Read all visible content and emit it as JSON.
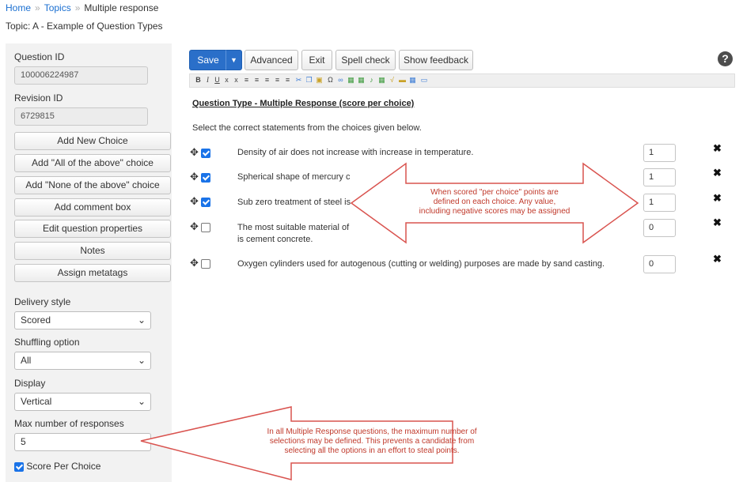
{
  "breadcrumb": {
    "home": "Home",
    "sep": "»",
    "topics": "Topics",
    "current": "Multiple response"
  },
  "topic_line": "Topic: A - Example of Question Types",
  "sidebar": {
    "question_id_label": "Question ID",
    "question_id_value": "100006224987",
    "revision_id_label": "Revision ID",
    "revision_id_value": "6729815",
    "buttons": [
      "Add New Choice",
      "Add \"All of the above\" choice",
      "Add \"None of the above\" choice",
      "Add comment box",
      "Edit question properties",
      "Notes",
      "Assign metatags"
    ],
    "delivery_label": "Delivery style",
    "delivery_value": "Scored",
    "shuffling_label": "Shuffling option",
    "shuffling_value": "All",
    "display_label": "Display",
    "display_value": "Vertical",
    "max_label": "Max number of responses",
    "max_value": "5",
    "score_per_choice_label": "Score Per Choice",
    "score_per_choice_checked": true
  },
  "toolbar": {
    "save": "Save",
    "advanced": "Advanced",
    "exit": "Exit",
    "spell": "Spell check",
    "feedback": "Show feedback",
    "help": "?"
  },
  "question": {
    "title": "Question Type - Multiple Response (score per choice)",
    "instruction": "Select the correct statements from the choices given below.",
    "choices": [
      {
        "line1": "Density of air does not increase with increase in temperature.",
        "line2": "",
        "checked": true,
        "score": "1"
      },
      {
        "line1": "Spherical shape of mercury c",
        "line2": "",
        "checked": true,
        "score": "1"
      },
      {
        "line1": "Sub zero treatment of steel is",
        "line2": "",
        "checked": true,
        "score": "1"
      },
      {
        "line1": "The most suitable material of",
        "line2": "is cement concrete.",
        "checked": false,
        "score": "0"
      },
      {
        "line1": "Oxygen cylinders used for autogenous (cutting or welding) purposes are made by sand casting.",
        "line2": "",
        "checked": false,
        "score": "0"
      }
    ]
  },
  "callouts": {
    "per_choice": [
      "When scored \"per choice\" points are",
      "defined on each choice.  Any value,",
      "including negative scores may be assigned"
    ],
    "max_responses": [
      "In all Multiple Response questions, the maximum number of",
      "selections may be defined.  This prevents a candidate from",
      "selecting all the options in an effort to steal points."
    ]
  },
  "colors": {
    "accent": "#2a6fc9",
    "callout_stroke": "#d9534f",
    "callout_text": "#c0392b"
  }
}
